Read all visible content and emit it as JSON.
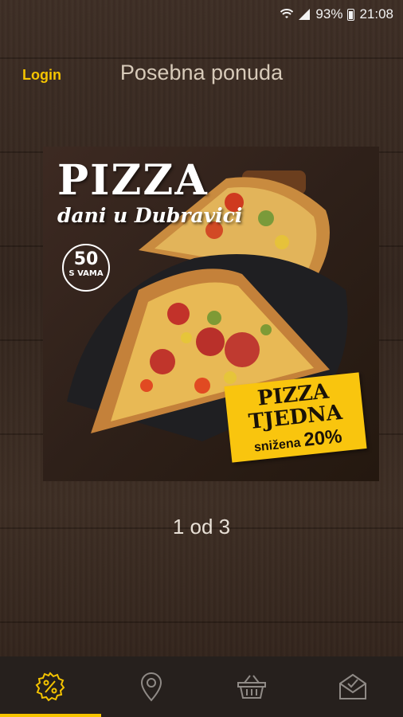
{
  "status_bar": {
    "battery": "93%",
    "time": "21:08",
    "icons": [
      "wifi-icon",
      "signal-icon",
      "battery-icon"
    ]
  },
  "header": {
    "login_label": "Login",
    "title": "Posebna ponuda"
  },
  "promo": {
    "headline": "PIZZA",
    "subline": "dani u Dubravici",
    "badge_number": "50",
    "badge_text": "S VAMA",
    "sticker_line1": "PIZZA",
    "sticker_line2": "TJEDNA",
    "sticker_line3": "snižena",
    "sticker_discount": "20%"
  },
  "pager": {
    "text": "1 od 3"
  },
  "bottom_nav": {
    "items": [
      {
        "icon": "discount-badge-icon",
        "active": true
      },
      {
        "icon": "location-pin-icon",
        "active": false
      },
      {
        "icon": "basket-icon",
        "active": false
      },
      {
        "icon": "order-check-icon",
        "active": false
      }
    ]
  },
  "colors": {
    "accent": "#f5c400",
    "nav_bg": "#26201d",
    "title": "#d7cab9"
  }
}
